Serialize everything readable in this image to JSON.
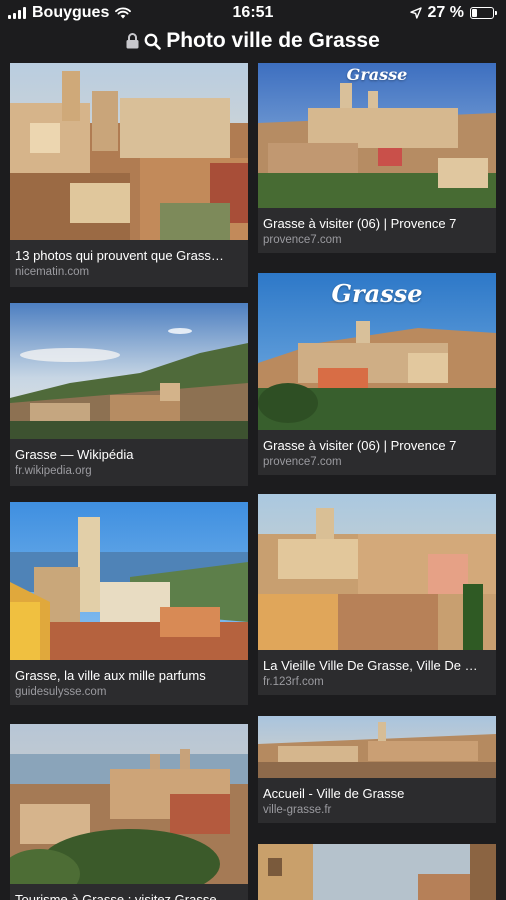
{
  "status": {
    "carrier": "Bouygues",
    "time": "16:51",
    "battery": "27 %",
    "battery_level": 0.27
  },
  "urlbar": {
    "query": "Photo ville de Grasse"
  },
  "results": [
    {
      "title": "13 photos qui prouvent que Grass…",
      "source": "nicematin.com"
    },
    {
      "title": "Grasse à visiter (06) | Provence 7",
      "source": "provence7.com",
      "watermark": "Grasse"
    },
    {
      "title": "Grasse — Wikipédia",
      "source": "fr.wikipedia.org"
    },
    {
      "title": "Grasse à visiter (06) | Provence 7",
      "source": "provence7.com",
      "watermark": "Grasse"
    },
    {
      "title": "Grasse, la ville aux mille parfums",
      "source": "guidesulysse.com"
    },
    {
      "title": "La Vieille Ville De Grasse, Ville De …",
      "source": "fr.123rf.com"
    },
    {
      "title": "Tourisme à Grasse : visitez Grasse",
      "source": ""
    },
    {
      "title": "Accueil - Ville de Grasse",
      "source": "ville-grasse.fr"
    }
  ]
}
